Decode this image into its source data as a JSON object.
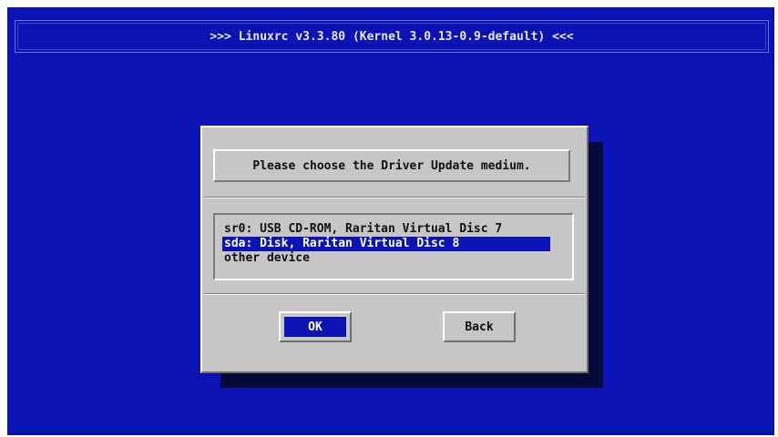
{
  "title": ">>> Linuxrc v3.3.80 (Kernel 3.0.13-0.9-default) <<<",
  "dialog": {
    "prompt": "Please choose the Driver Update medium.",
    "devices": [
      {
        "label": "sr0: USB CD-ROM, Raritan Virtual Disc 7",
        "selected": false
      },
      {
        "label": "sda: Disk, Raritan Virtual Disc 8",
        "selected": true
      },
      {
        "label": "other device",
        "selected": false
      }
    ],
    "buttons": {
      "ok": "OK",
      "back": "Back"
    }
  },
  "colors": {
    "background": "#0b13b4",
    "dialog": "#c6c6c6",
    "selection": "#0b13b4"
  }
}
